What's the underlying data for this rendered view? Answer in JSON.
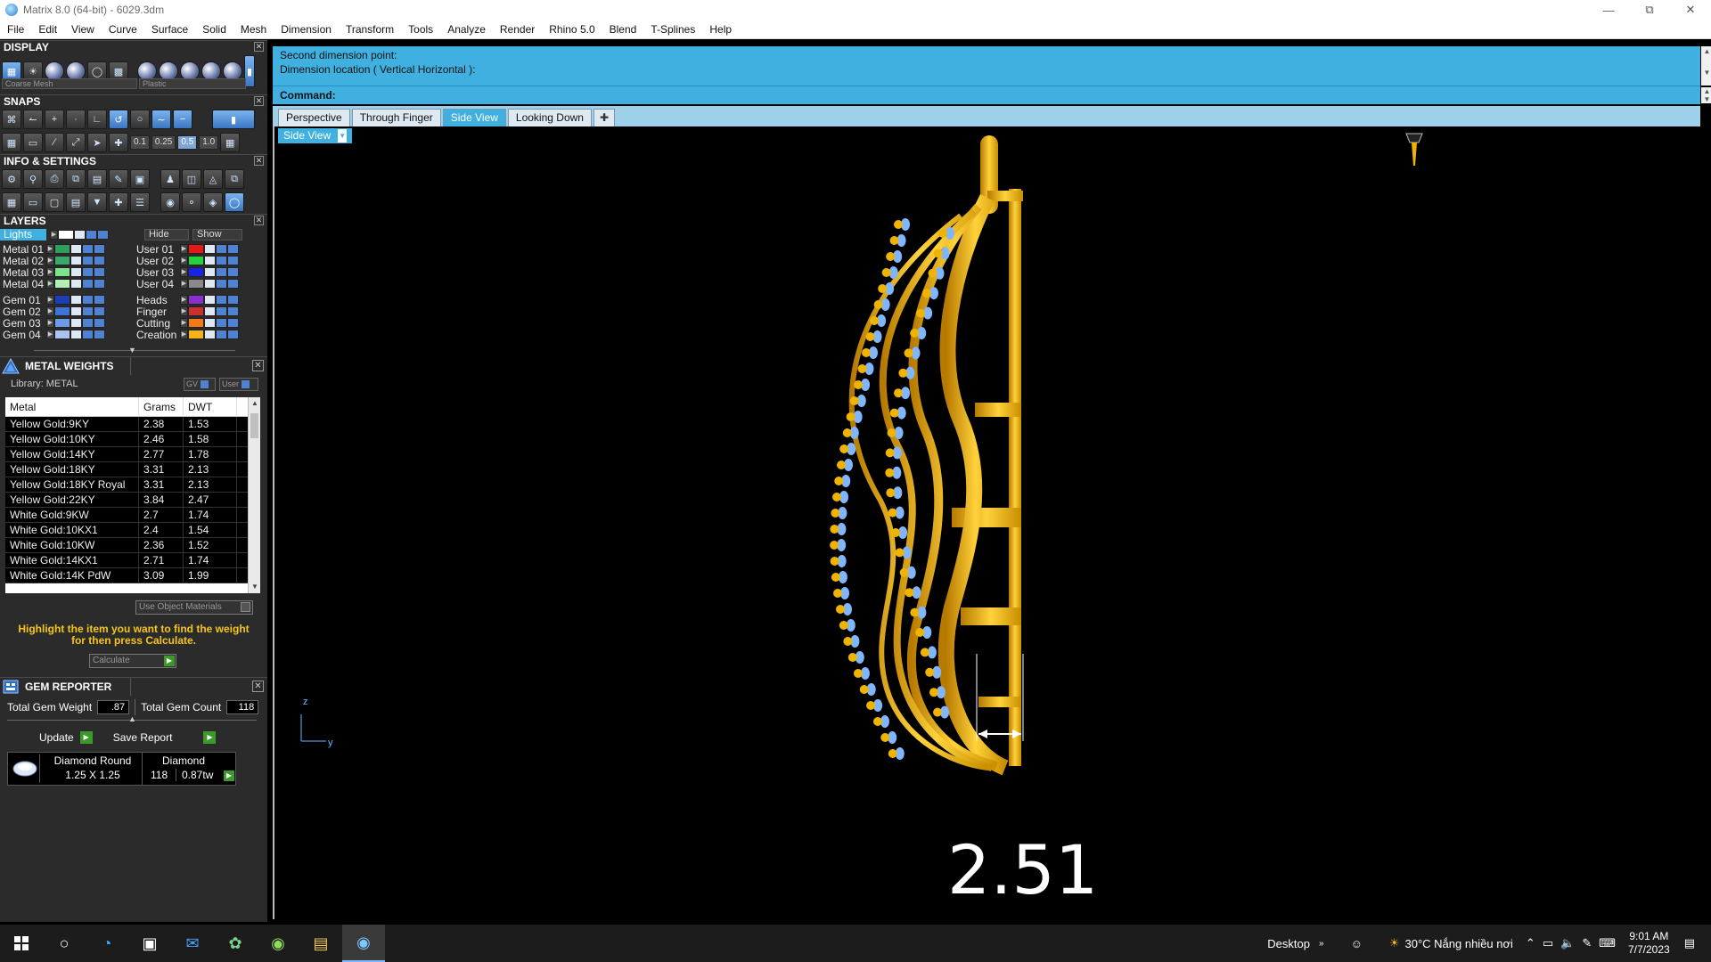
{
  "window": {
    "title": "Matrix 8.0 (64-bit) - 6029.3dm"
  },
  "menu": [
    "File",
    "Edit",
    "View",
    "Curve",
    "Surface",
    "Solid",
    "Mesh",
    "Dimension",
    "Transform",
    "Tools",
    "Analyze",
    "Render",
    "Rhino 5.0",
    "Blend",
    "T-Splines",
    "Help"
  ],
  "display": {
    "title": "DISPLAY",
    "mesh_select": "Coarse Mesh",
    "material_select": "Plastic"
  },
  "snaps": {
    "title": "SNAPS",
    "values": [
      "0.1",
      "0.25",
      "0.5",
      "1.0"
    ]
  },
  "info": {
    "title": "INFO & SETTINGS"
  },
  "layers": {
    "title": "LAYERS",
    "lights_label": "Lights",
    "hide_label": "Hide",
    "show_label": "Show",
    "left": [
      {
        "name": "Metal 01",
        "color": "#2e9e5b"
      },
      {
        "name": "Metal 02",
        "color": "#3aa86a"
      },
      {
        "name": "Metal 03",
        "color": "#7de38a"
      },
      {
        "name": "Metal 04",
        "color": "#aef0b5"
      },
      {
        "name": "Gem 01",
        "color": "#1c3fb5"
      },
      {
        "name": "Gem 02",
        "color": "#3f73d6"
      },
      {
        "name": "Gem 03",
        "color": "#6f9be6"
      },
      {
        "name": "Gem 04",
        "color": "#a9c4f2"
      }
    ],
    "right": [
      {
        "name": "User 01",
        "color": "#e31a1a"
      },
      {
        "name": "User 02",
        "color": "#22d43a"
      },
      {
        "name": "User 03",
        "color": "#1a22e3"
      },
      {
        "name": "User 04",
        "color": "#8a8a8a"
      },
      {
        "name": "Heads",
        "color": "#8a2fc9"
      },
      {
        "name": "Finger",
        "color": "#c9302f"
      },
      {
        "name": "Cutting",
        "color": "#f07a1a"
      },
      {
        "name": "Creation",
        "color": "#f5b21a"
      }
    ]
  },
  "metal_weights": {
    "title": "METAL WEIGHTS",
    "library": "Library: METAL",
    "gv_label": "GV",
    "user_label": "User",
    "columns": [
      "Metal",
      "Grams",
      "DWT"
    ],
    "rows": [
      [
        "Yellow Gold:9KY",
        "2.38",
        "1.53"
      ],
      [
        "Yellow Gold:10KY",
        "2.46",
        "1.58"
      ],
      [
        "Yellow Gold:14KY",
        "2.77",
        "1.78"
      ],
      [
        "Yellow Gold:18KY",
        "3.31",
        "2.13"
      ],
      [
        "Yellow Gold:18KY Royal",
        "3.31",
        "2.13"
      ],
      [
        "Yellow Gold:22KY",
        "3.84",
        "2.47"
      ],
      [
        "White Gold:9KW",
        "2.7",
        "1.74"
      ],
      [
        "White Gold:10KX1",
        "2.4",
        "1.54"
      ],
      [
        "White Gold:10KW",
        "2.36",
        "1.52"
      ],
      [
        "White Gold:14KX1",
        "2.71",
        "1.74"
      ],
      [
        "White Gold:14K PdW",
        "3.09",
        "1.99"
      ]
    ],
    "use_object_materials": "Use Object Materials",
    "message": "Highlight the item you want to find the weight for then press Calculate.",
    "calculate": "Calculate"
  },
  "gem_reporter": {
    "title": "GEM REPORTER",
    "total_weight_label": "Total Gem Weight",
    "total_weight": ".87",
    "total_count_label": "Total Gem Count",
    "total_count": "118",
    "update": "Update",
    "save_report": "Save Report",
    "gem": {
      "shape": "Diamond Round",
      "size": "1.25 X 1.25",
      "material": "Diamond",
      "count": "118",
      "weight": "0.87tw"
    }
  },
  "command": {
    "line1": "Second dimension point:",
    "line2": "Dimension location ( Vertical  Horizontal ):",
    "label": "Command:"
  },
  "tabs": [
    "Perspective",
    "Through Finger",
    "Side View",
    "Looking Down"
  ],
  "viewport": {
    "label": "Side View",
    "dimension": "2.51",
    "axis_z": "z",
    "axis_y": "y"
  },
  "taskbar": {
    "desktop": "Desktop",
    "weather": "30°C  Nắng nhiều nơi",
    "time": "9:01 AM",
    "date": "7/7/2023"
  },
  "colors": {
    "accent": "#3fb0e0",
    "gold": "#f0b400",
    "gem": "#7fb6ff"
  }
}
